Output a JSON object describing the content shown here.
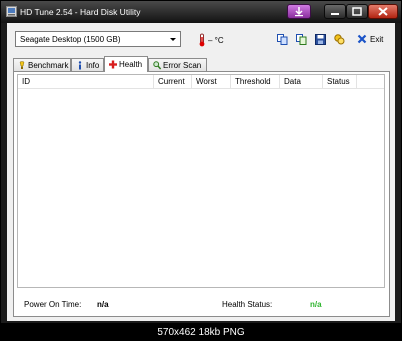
{
  "window": {
    "title": "HD Tune 2.54 - Hard Disk Utility"
  },
  "toolbar": {
    "drive": "Seagate Desktop (1500 GB)",
    "temperature": "– °C",
    "exit_label": "Exit"
  },
  "tabs": [
    {
      "label": "Benchmark",
      "icon": "benchmark-icon"
    },
    {
      "label": "Info",
      "icon": "info-icon"
    },
    {
      "label": "Health",
      "icon": "health-cross-icon"
    },
    {
      "label": "Error Scan",
      "icon": "magnifier-icon"
    }
  ],
  "grid": {
    "columns": [
      "ID",
      "Current",
      "Worst",
      "Threshold",
      "Data",
      "Status"
    ]
  },
  "footer": {
    "power_on_label": "Power On Time:",
    "power_on_value": "n/a",
    "health_label": "Health Status:",
    "health_value": "n/a"
  },
  "caption": "570x462 18kb PNG",
  "colors": {
    "health_status_value": "#2fb52f",
    "accent_button": "#a63fbd",
    "close_button": "#c4331f"
  }
}
